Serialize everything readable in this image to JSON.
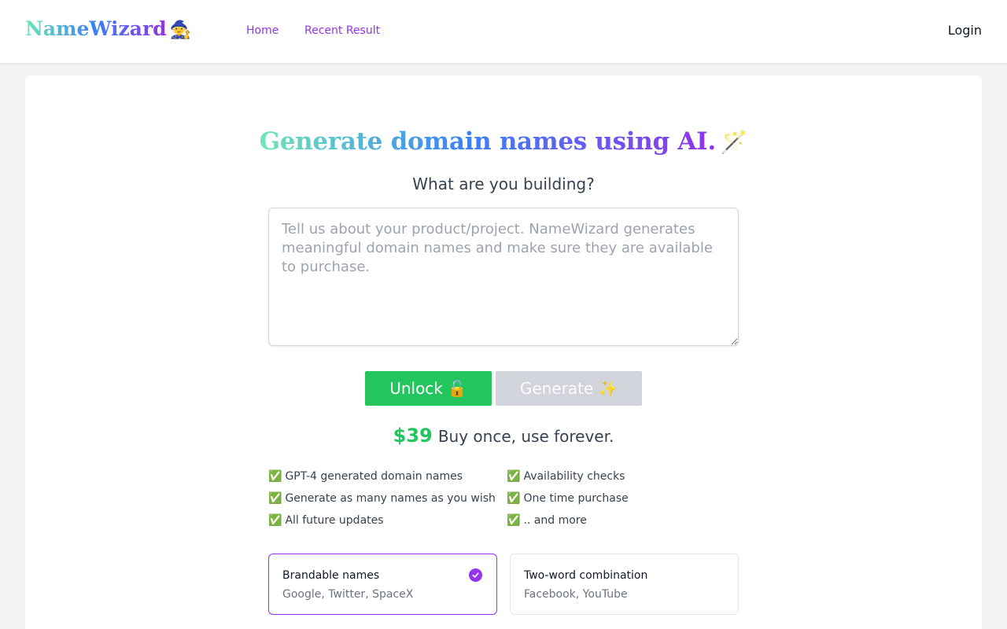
{
  "nav": {
    "logo_text": "NameWizard",
    "logo_emoji": "🧙",
    "home": "Home",
    "recent": "Recent Result",
    "login": "Login"
  },
  "hero": {
    "headline": "Generate domain names using AI.",
    "headline_emoji": "🪄",
    "subheading": "What are you building?"
  },
  "input": {
    "placeholder": "Tell us about your product/project. NameWizard generates meaningful domain names and make sure they are available to purchase.",
    "value": ""
  },
  "buttons": {
    "unlock": "Unlock",
    "unlock_emoji": "🔓",
    "generate": "Generate",
    "generate_emoji": "✨"
  },
  "pricing": {
    "price": "$39",
    "text": "Buy once, use forever."
  },
  "features": {
    "col1": [
      "GPT-4 generated domain names",
      "Generate as many names as you wish",
      "All future updates"
    ],
    "col2": [
      "Availability checks",
      "One time purchase",
      ".. and more"
    ],
    "check": "✅"
  },
  "options": [
    {
      "title": "Brandable names",
      "desc": "Google, Twitter, SpaceX",
      "selected": true
    },
    {
      "title": "Two-word combination",
      "desc": "Facebook, YouTube",
      "selected": false
    }
  ],
  "colors": {
    "accent": "#9333ea",
    "success": "#22c55e",
    "disabled": "#d1d5db"
  }
}
